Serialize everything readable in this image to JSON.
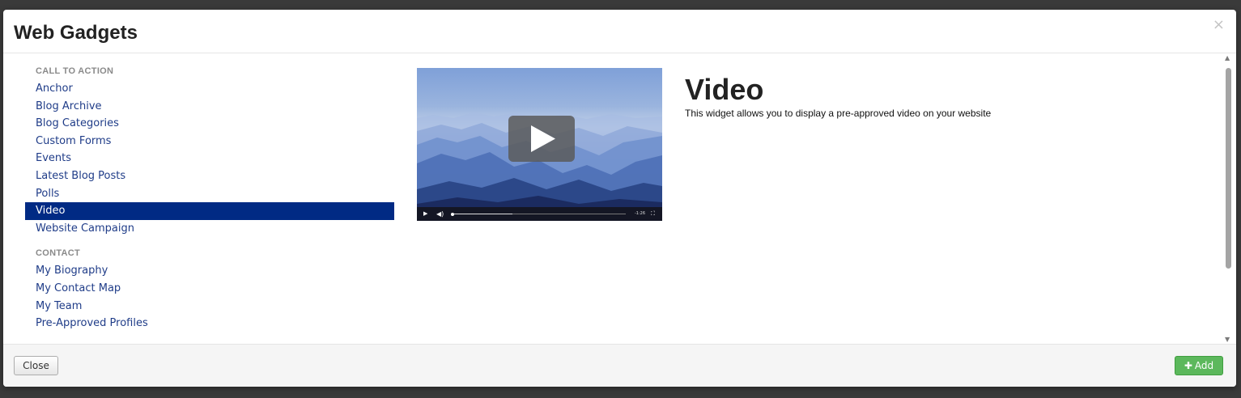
{
  "modal": {
    "title": "Web Gadgets",
    "close_glyph": "×"
  },
  "sidebar": {
    "sections": [
      {
        "label": "CALL TO ACTION",
        "items": [
          {
            "label": "Anchor"
          },
          {
            "label": "Blog Archive"
          },
          {
            "label": "Blog Categories"
          },
          {
            "label": "Custom Forms"
          },
          {
            "label": "Events"
          },
          {
            "label": "Latest Blog Posts"
          },
          {
            "label": "Polls"
          },
          {
            "label": "Video",
            "active": true
          },
          {
            "label": "Website Campaign"
          }
        ]
      },
      {
        "label": "CONTACT",
        "items": [
          {
            "label": "My Biography"
          },
          {
            "label": "My Contact Map"
          },
          {
            "label": "My Team"
          },
          {
            "label": "Pre-Approved Profiles"
          }
        ]
      }
    ]
  },
  "detail": {
    "title": "Video",
    "description": "This widget allows you to display a pre-approved video on your website"
  },
  "video_player": {
    "time": "-1:26",
    "progress": 0.35,
    "icons": [
      "play-icon",
      "volume-icon",
      "fullscreen-icon"
    ]
  },
  "footer": {
    "close_label": "Close",
    "add_label": "Add",
    "add_icon": "plus-icon"
  },
  "colors": {
    "active_bg": "#012a84",
    "link": "#1f3c88",
    "add_button": "#5cb85c"
  }
}
